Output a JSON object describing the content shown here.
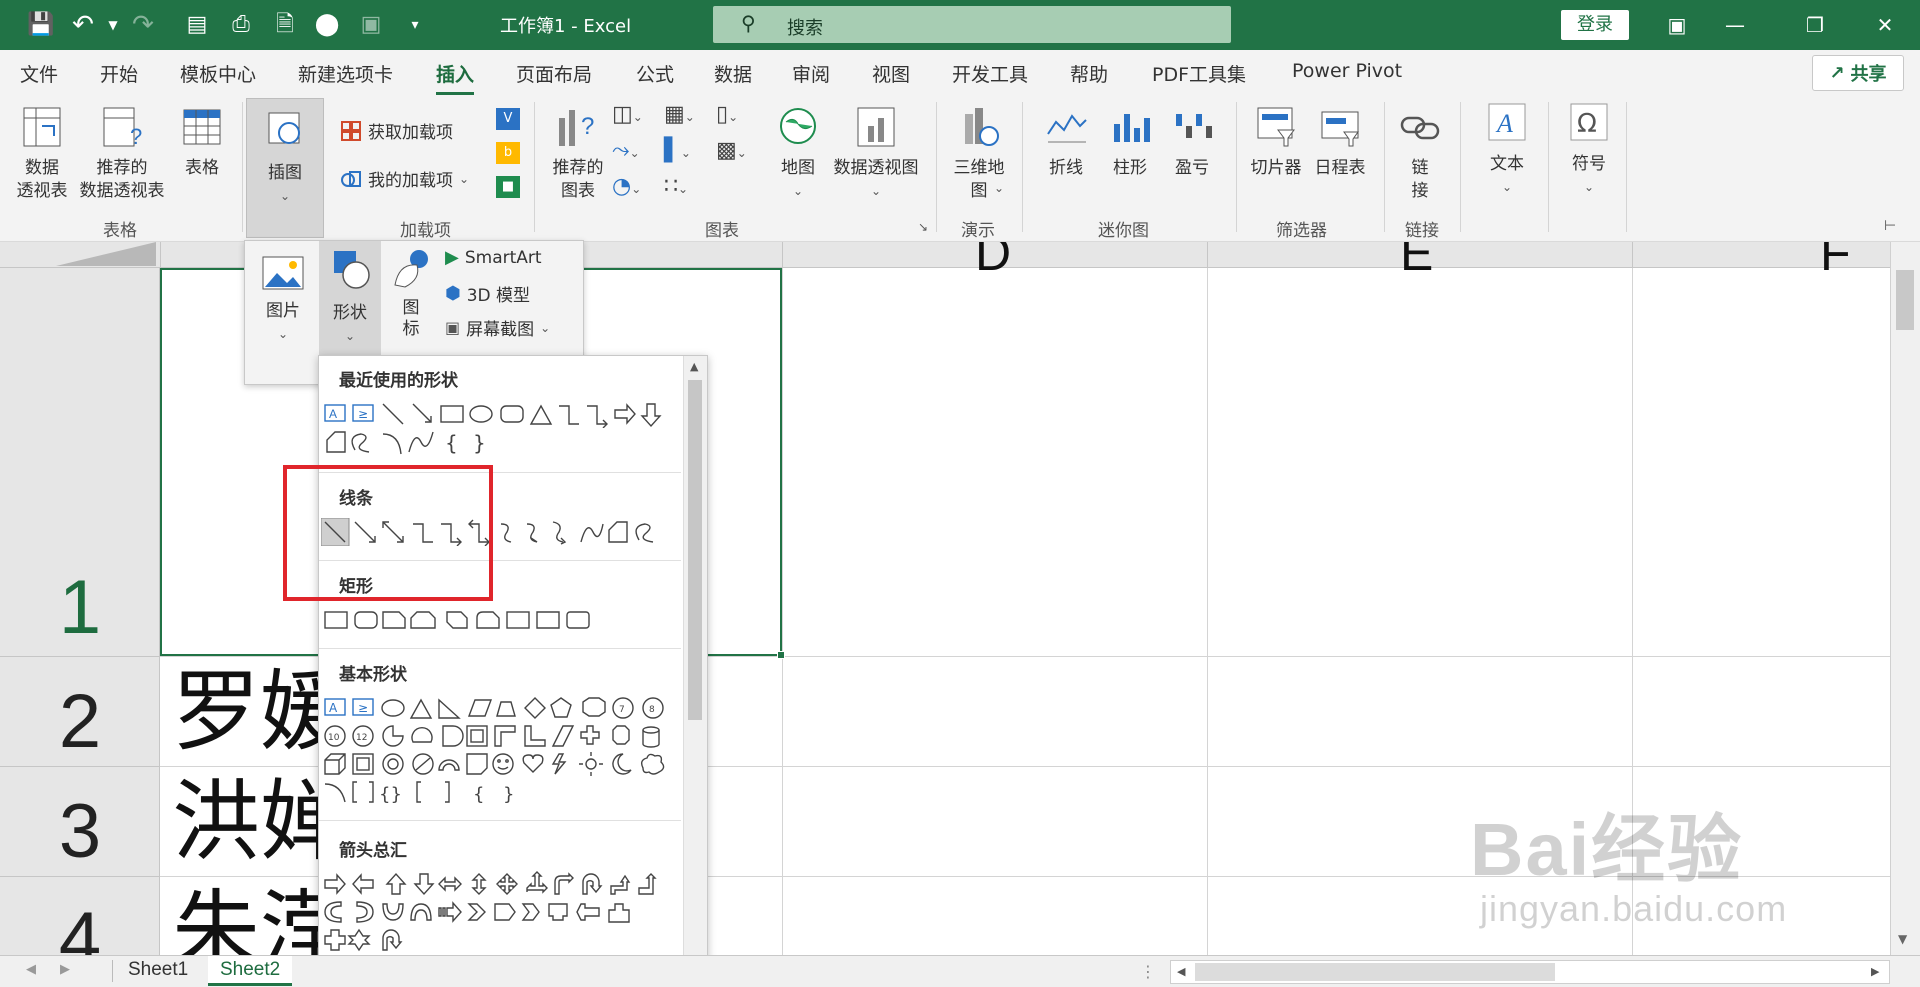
{
  "window": {
    "title": "工作簿1  -  Excel"
  },
  "search": {
    "placeholder": "搜索"
  },
  "account": {
    "login_label": "登录"
  },
  "tabs": [
    "文件",
    "开始",
    "模板中心",
    "新建选项卡",
    "插入",
    "页面布局",
    "公式",
    "数据",
    "审阅",
    "视图",
    "开发工具",
    "帮助",
    "PDF工具集",
    "Power Pivot"
  ],
  "active_tab": "插入",
  "share_label": "共享",
  "ribbon": {
    "tables": {
      "pivot": "数据\n透视表",
      "recommended_pivot": "推荐的\n数据透视表",
      "table": "表格",
      "group": "表格"
    },
    "illustrations": {
      "label": "插图"
    },
    "addins": {
      "get": "获取加载项",
      "my": "我的加载项",
      "group": "加载项"
    },
    "charts": {
      "recommended": "推荐的\n图表",
      "map": "地图",
      "pivot_chart": "数据透视图",
      "group": "图表"
    },
    "tours": {
      "map3d": "三维地\n图",
      "group": "演示"
    },
    "sparklines": {
      "line": "折线",
      "column": "柱形",
      "winloss": "盈亏",
      "group": "迷你图"
    },
    "filters": {
      "slicer": "切片器",
      "timeline": "日程表",
      "group": "筛选器"
    },
    "links": {
      "link": "链\n接",
      "group": "链接"
    },
    "text": {
      "label": "文本"
    },
    "symbols": {
      "label": "符号"
    }
  },
  "insert_panel": {
    "picture": "图片",
    "shapes": "形状",
    "icons": "图\n标",
    "smartart": "SmartArt",
    "model3d": "3D 模型",
    "screenshot": "屏幕截图"
  },
  "shapes_gallery": {
    "sections": [
      "最近使用的形状",
      "线条",
      "矩形",
      "基本形状",
      "箭头总汇"
    ]
  },
  "grid": {
    "rows": [
      "1",
      "2",
      "3",
      "4"
    ],
    "cells": [
      "罗媛",
      "洪婵",
      "朱滢"
    ]
  },
  "sheets": [
    "Sheet1",
    "Sheet2"
  ],
  "active_sheet": "Sheet2",
  "watermark": {
    "brand": "Bai经验",
    "url": "jingyan.baidu.com"
  }
}
